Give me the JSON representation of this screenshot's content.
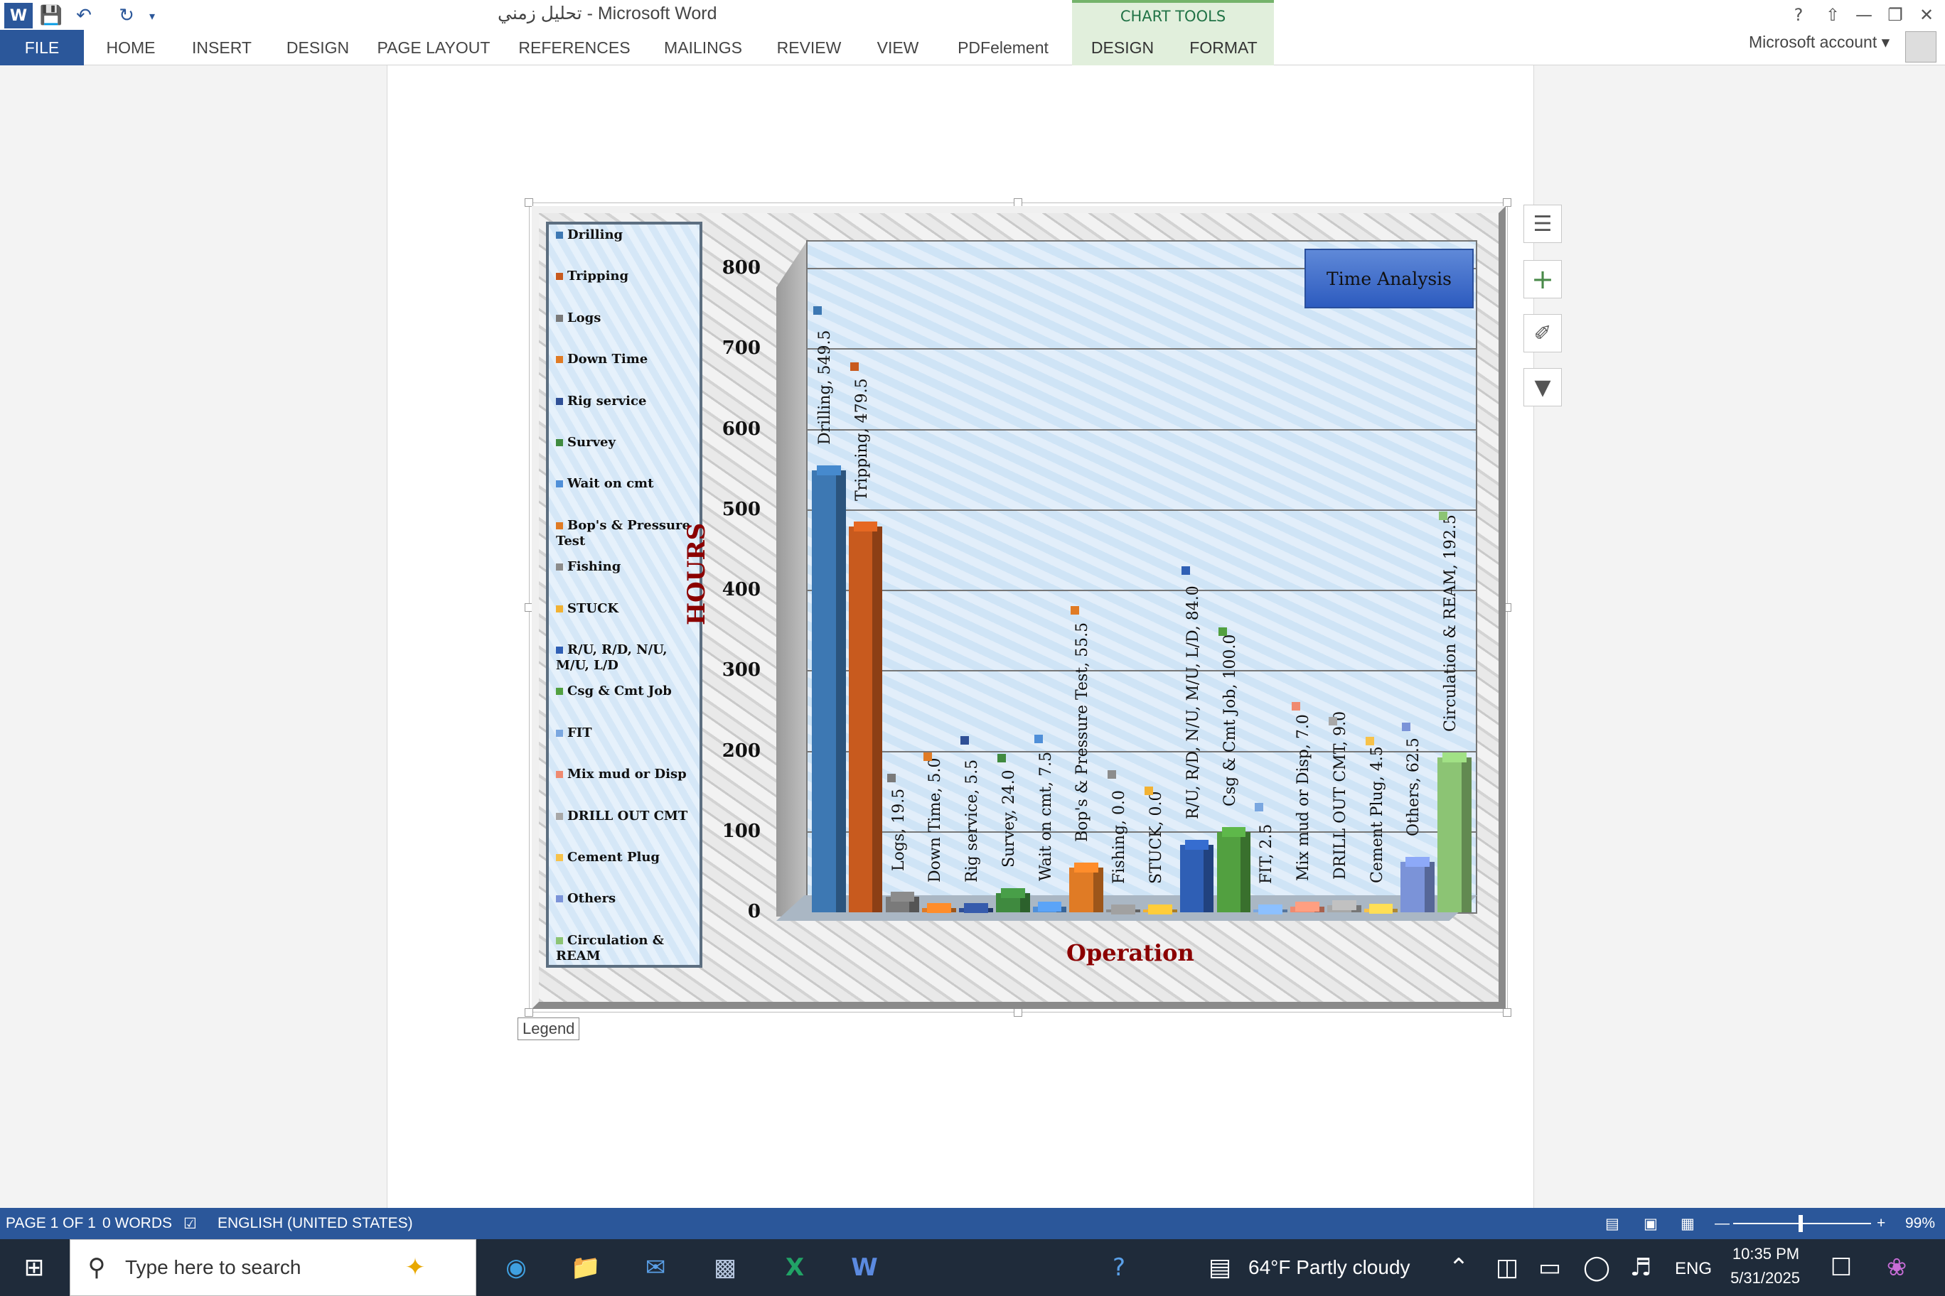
{
  "titlebar": {
    "document_title": "تحليل زمني - Microsoft Word",
    "chart_tools_label": "CHART TOOLS",
    "help_glyph": "?"
  },
  "ribbon": {
    "tabs": [
      "FILE",
      "HOME",
      "INSERT",
      "DESIGN",
      "PAGE LAYOUT",
      "REFERENCES",
      "MAILINGS",
      "REVIEW",
      "VIEW",
      "PDFelement",
      "DESIGN",
      "FORMAT"
    ],
    "account": "Microsoft account"
  },
  "chart_data": {
    "type": "bar",
    "title": "Time Analysis",
    "xlabel": "Operation",
    "ylabel": "HOURS",
    "ylim": [
      0,
      800
    ],
    "yticks": [
      "0",
      "100",
      "200",
      "300",
      "400",
      "500",
      "600",
      "700",
      "800"
    ],
    "legend_position": "left",
    "categories": [
      "Drilling",
      "Tripping",
      "Logs",
      "Down Time",
      "Rig service",
      "Survey",
      "Wait on cmt",
      "Bop's & Pressure Test",
      "Fishing",
      "STUCK",
      "R/U, R/D, N/U, M/U, L/D",
      "Csg & Cmt Job",
      "FIT",
      "Mix mud or Disp",
      "DRILL OUT CMT",
      "Cement Plug",
      "Others",
      "Circulation & REAM"
    ],
    "values": [
      549.5,
      479.5,
      19.5,
      5.0,
      5.5,
      24.0,
      7.5,
      55.5,
      0.0,
      0.0,
      84.0,
      100.0,
      2.5,
      7.0,
      9.0,
      4.5,
      62.5,
      192.5
    ],
    "data_labels": [
      "Drilling, 549.5",
      "Tripping, 479.5",
      "Logs, 19.5",
      "Down Time, 5.0",
      "Rig service, 5.5",
      "Survey, 24.0",
      "Wait on cmt, 7.5",
      "Bop's & Pressure Test, 55.5",
      "Fishing, 0.0",
      "STUCK, 0.0",
      "R/U, R/D, N/U, M/U, L/D, 84.0",
      "Csg & Cmt Job, 100.0",
      "FIT, 2.5",
      "Mix mud or Disp, 7.0",
      "DRILL OUT CMT, 9.0",
      "Cement Plug, 4.5",
      "Others, 62.5",
      "Circulation & REAM, 192.5"
    ],
    "colors": [
      "#3d78b3",
      "#c85a1e",
      "#7a7a7a",
      "#e07b25",
      "#2f4f96",
      "#3f8a3f",
      "#4f8fd8",
      "#e07b25",
      "#8c8c8c",
      "#f2b233",
      "#2f5fb5",
      "#52a040",
      "#7aa7e0",
      "#f08a70",
      "#a8a8a8",
      "#f7c24a",
      "#7b93d8",
      "#8cc474"
    ]
  },
  "chart_ui": {
    "legend_tag": "Legend"
  },
  "statusbar": {
    "page": "PAGE 1 OF 1",
    "words": "0 WORDS",
    "language": "ENGLISH (UNITED STATES)",
    "zoom": "99%"
  },
  "taskbar": {
    "search_placeholder": "Type here to search",
    "weather": "64°F  Partly cloudy",
    "lang": "ENG",
    "time": "10:35 PM",
    "date": "5/31/2025"
  }
}
